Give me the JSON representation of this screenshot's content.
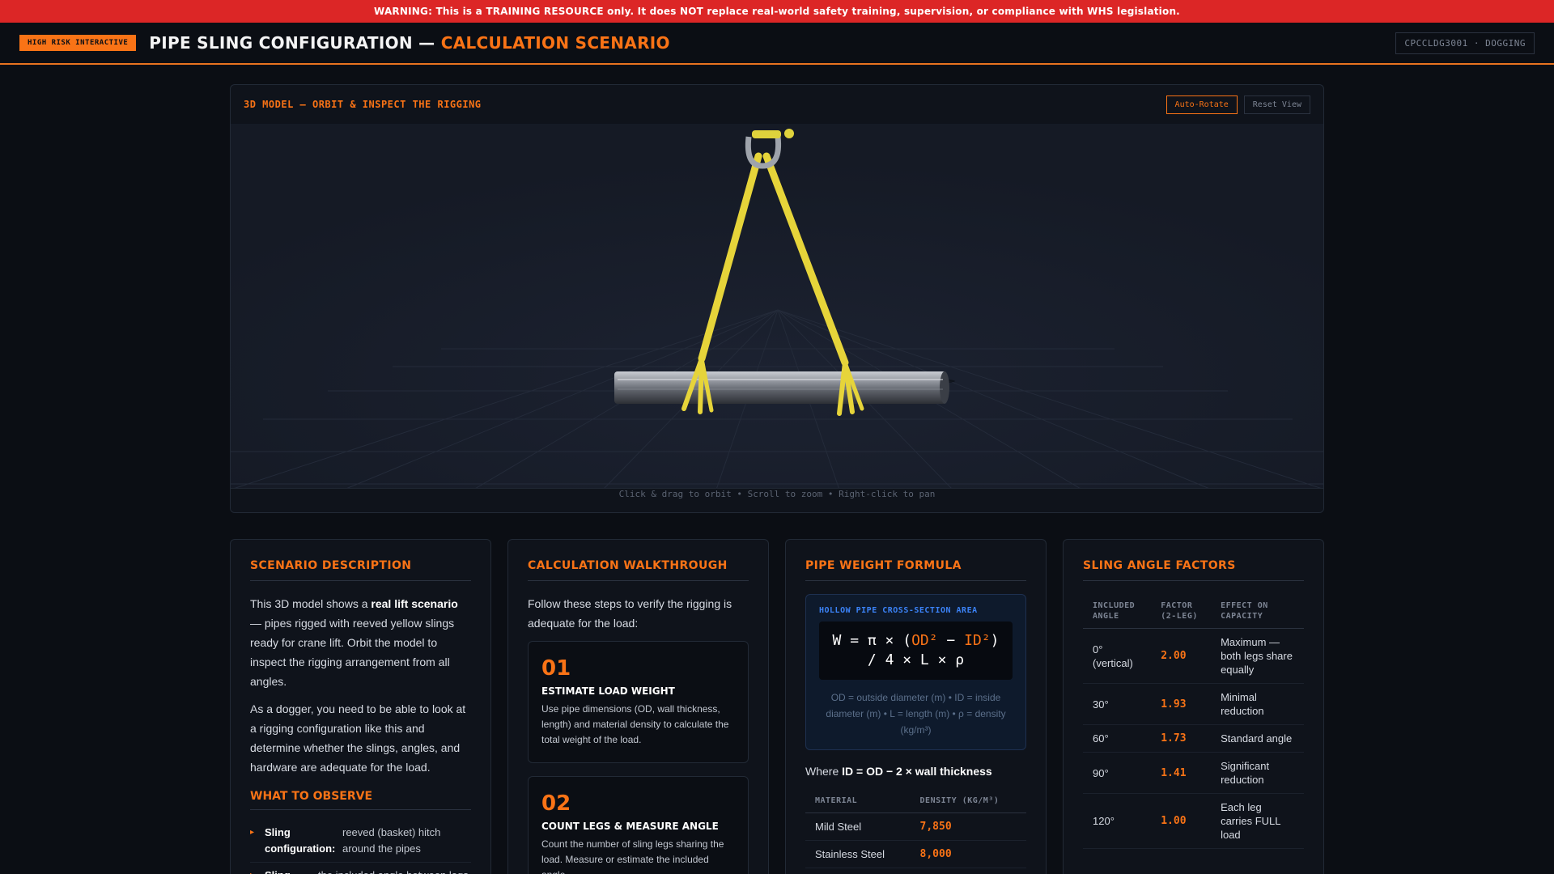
{
  "warning": "WARNING: This is a TRAINING RESOURCE only. It does NOT replace real-world safety training, supervision, or compliance with WHS legislation.",
  "header": {
    "badge": "High Risk Interactive",
    "title_main": "PIPE SLING CONFIGURATION —",
    "title_accent": "CALCULATION SCENARIO",
    "course_code": "CPCCLDG3001 · DOGGING"
  },
  "viewer": {
    "title": "3D MODEL — ORBIT & INSPECT THE RIGGING",
    "auto_rotate": "Auto-Rotate",
    "reset_view": "Reset View",
    "hint": "Click & drag to orbit • Scroll to zoom • Right-click to pan"
  },
  "scenario": {
    "heading": "SCENARIO DESCRIPTION",
    "p1_pre": "This 3D model shows a ",
    "p1_bold": "real lift scenario",
    "p1_post": " — pipes rigged with reeved yellow slings ready for crane lift. Orbit the model to inspect the rigging arrangement from all angles.",
    "p2": "As a dogger, you need to be able to look at a rigging configuration like this and determine whether the slings, angles, and hardware are adequate for the load.",
    "observe_heading": "WHAT TO OBSERVE",
    "observe": [
      {
        "key": "Sling configuration:",
        "value": "reeved (basket) hitch around the pipes"
      },
      {
        "key": "Sling",
        "value": "the included angle between legs"
      }
    ]
  },
  "walkthrough": {
    "heading": "CALCULATION WALKTHROUGH",
    "intro": "Follow these steps to verify the rigging is adequate for the load:",
    "steps": [
      {
        "num": "01",
        "name": "ESTIMATE LOAD WEIGHT",
        "desc": "Use pipe dimensions (OD, wall thickness, length) and material density to calculate the total weight of the load."
      },
      {
        "num": "02",
        "name": "COUNT LEGS & MEASURE ANGLE",
        "desc": "Count the number of sling legs sharing the load. Measure or estimate the included angle"
      }
    ]
  },
  "formula": {
    "heading": "PIPE WEIGHT FORMULA",
    "box_label": "HOLLOW PIPE CROSS-SECTION AREA",
    "line1_a": "W = π × (",
    "line1_od": "OD²",
    "line1_b": " − ",
    "line1_id": "ID²",
    "line1_c": ")",
    "line2": "/ 4 × L × ρ",
    "note": "OD = outside diameter (m) • ID = inside diameter (m) • L = length (m) • ρ = density (kg/m³)",
    "where_pre": "Where ",
    "where_bold": "ID = OD − 2 × wall thickness",
    "table_headers": [
      "MATERIAL",
      "DENSITY (KG/M³)"
    ],
    "rows": [
      {
        "material": "Mild Steel",
        "density": "7,850"
      },
      {
        "material": "Stainless Steel",
        "density": "8,000"
      }
    ]
  },
  "angles": {
    "heading": "SLING ANGLE FACTORS",
    "headers": [
      "INCLUDED ANGLE",
      "FACTOR (2-LEG)",
      "EFFECT ON CAPACITY"
    ],
    "rows": [
      {
        "angle": "0° (vertical)",
        "factor": "2.00",
        "effect": "Maximum — both legs share equally"
      },
      {
        "angle": "30°",
        "factor": "1.93",
        "effect": "Minimal reduction"
      },
      {
        "angle": "60°",
        "factor": "1.73",
        "effect": "Standard angle"
      },
      {
        "angle": "90°",
        "factor": "1.41",
        "effect": "Significant reduction"
      },
      {
        "angle": "120°",
        "factor": "1.00",
        "effect": "Each leg carries FULL load"
      }
    ]
  },
  "colors": {
    "accent": "#f97316",
    "warning_bg": "#dc2626",
    "sling": "#e8d83a",
    "background": "#0b0e14"
  }
}
